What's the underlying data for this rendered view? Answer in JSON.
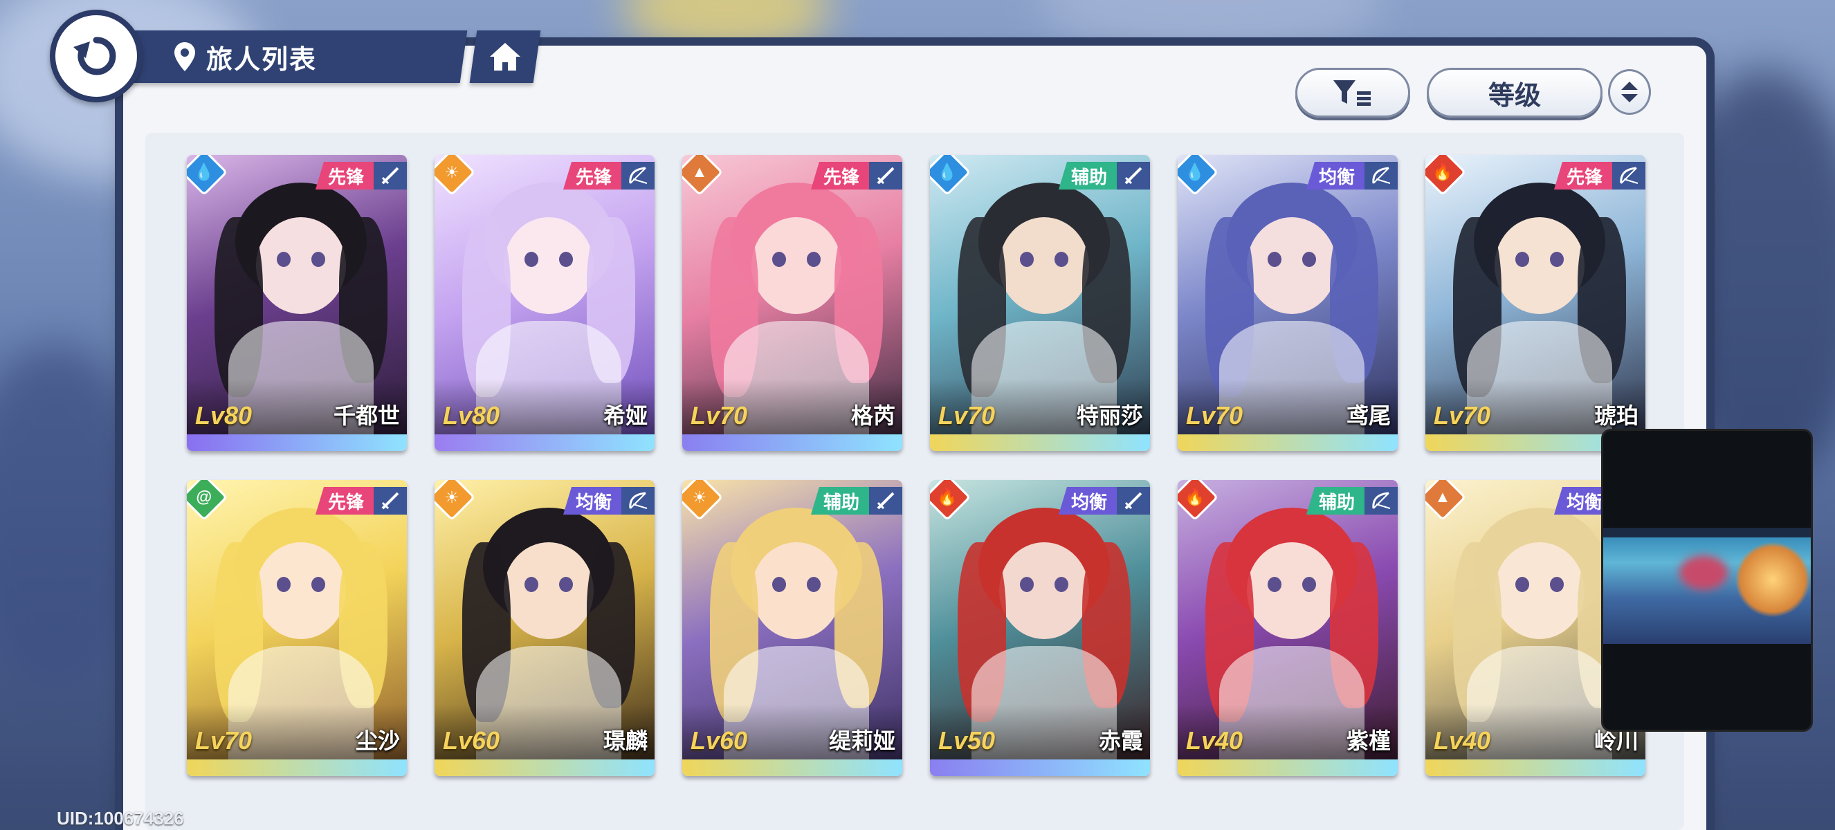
{
  "header": {
    "title": "旅人列表"
  },
  "toolbar": {
    "sort_label": "等级"
  },
  "colors": {
    "panel_border": "#2f3f66",
    "element_water": "#2e8fe0",
    "element_light": "#f29a2e",
    "element_earth": "#e07a3a",
    "element_fire": "#e0402e",
    "element_wind": "#3cae5a",
    "role_vanguard": "#e8457a",
    "role_support": "#2fb58a",
    "role_balance": "#6a5ad8"
  },
  "characters": [
    {
      "level": "Lv80",
      "name": "千都世",
      "role": "先锋",
      "element": "water-icon",
      "weapon": "sword-icon"
    },
    {
      "level": "Lv80",
      "name": "希娅",
      "role": "先锋",
      "element": "light-icon",
      "weapon": "bow-icon"
    },
    {
      "level": "Lv70",
      "name": "格芮",
      "role": "先锋",
      "element": "earth-icon",
      "weapon": "sword-icon"
    },
    {
      "level": "Lv70",
      "name": "特丽莎",
      "role": "辅助",
      "element": "water-icon",
      "weapon": "sword-icon"
    },
    {
      "level": "Lv70",
      "name": "鸢尾",
      "role": "均衡",
      "element": "water-icon",
      "weapon": "bow-icon"
    },
    {
      "level": "Lv70",
      "name": "琥珀",
      "role": "先锋",
      "element": "fire-icon",
      "weapon": "bow-icon"
    },
    {
      "level": "Lv70",
      "name": "尘沙",
      "role": "先锋",
      "element": "wind-icon",
      "weapon": "sword-icon"
    },
    {
      "level": "Lv60",
      "name": "璟麟",
      "role": "均衡",
      "element": "light-icon",
      "weapon": "bow-icon"
    },
    {
      "level": "Lv60",
      "name": "缇莉娅",
      "role": "辅助",
      "element": "light-icon",
      "weapon": "sword-icon"
    },
    {
      "level": "Lv50",
      "name": "赤霞",
      "role": "均衡",
      "element": "fire-icon",
      "weapon": "sword-icon"
    },
    {
      "level": "Lv40",
      "name": "紫槿",
      "role": "辅助",
      "element": "fire-icon",
      "weapon": "bow-icon"
    },
    {
      "level": "Lv40",
      "name": "岭川",
      "role": "均衡",
      "element": "earth-icon",
      "weapon": "bow-icon"
    }
  ],
  "footer": {
    "uid": "UID:100674326"
  }
}
